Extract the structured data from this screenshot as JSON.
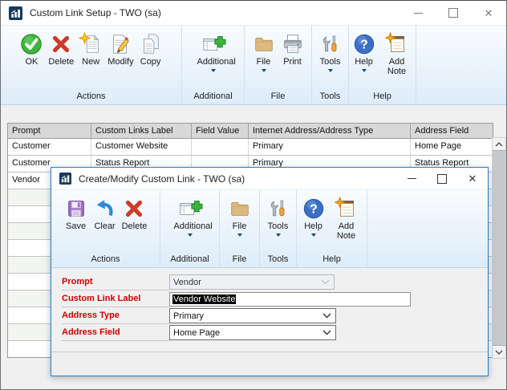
{
  "colors": {
    "dialog_border": "#1e82d2",
    "required_label_red": "#cc0000",
    "ribbon_bg_top": "#f9fcfe",
    "ribbon_bg_bottom": "#ddecf9",
    "table_header_bg": "#d8d8d8",
    "selection_bg": "#000000",
    "selection_text": "#ffffff"
  },
  "main_window": {
    "title": "Custom Link Setup  -  TWO (sa)",
    "toolbar": {
      "groups": [
        {
          "label": "Actions",
          "buttons": [
            {
              "label": "OK"
            },
            {
              "label": "Delete"
            },
            {
              "label": "New"
            },
            {
              "label": "Modify"
            },
            {
              "label": "Copy"
            }
          ]
        },
        {
          "label": "Additional",
          "buttons": [
            {
              "label": "Additional",
              "dropdown": true
            }
          ]
        },
        {
          "label": "File",
          "buttons": [
            {
              "label": "File",
              "dropdown": true
            },
            {
              "label": "Print"
            }
          ]
        },
        {
          "label": "Tools",
          "buttons": [
            {
              "label": "Tools",
              "dropdown": true
            }
          ]
        },
        {
          "label": "Help",
          "buttons": [
            {
              "label": "Help",
              "dropdown": true
            },
            {
              "label": "Add Note"
            }
          ]
        }
      ]
    },
    "table": {
      "columns": [
        "Prompt",
        "Custom Links Label",
        "Field Value",
        "Internet Address/Address Type",
        "Address Field"
      ],
      "rows": [
        [
          "Customer",
          "Customer Website",
          "",
          "Primary",
          "Home Page"
        ],
        [
          "Customer",
          "Status Report",
          "",
          "Primary",
          "Status Report"
        ],
        [
          "Vendor",
          "",
          "",
          "",
          ""
        ]
      ]
    }
  },
  "dialog": {
    "title": "Create/Modify Custom Link  -  TWO (sa)",
    "toolbar": {
      "groups": [
        {
          "label": "Actions",
          "buttons": [
            {
              "label": "Save"
            },
            {
              "label": "Clear"
            },
            {
              "label": "Delete"
            }
          ]
        },
        {
          "label": "Additional",
          "buttons": [
            {
              "label": "Additional",
              "dropdown": true
            }
          ]
        },
        {
          "label": "File",
          "buttons": [
            {
              "label": "File",
              "dropdown": true
            }
          ]
        },
        {
          "label": "Tools",
          "buttons": [
            {
              "label": "Tools",
              "dropdown": true
            }
          ]
        },
        {
          "label": "Help",
          "buttons": [
            {
              "label": "Help",
              "dropdown": true
            },
            {
              "label": "Add Note"
            }
          ]
        }
      ]
    },
    "form": {
      "fields": [
        {
          "label": "Prompt",
          "value": "Vendor",
          "state": "disabled-combo"
        },
        {
          "label": "Custom Link Label",
          "value": "Vendor Website",
          "state": "text-selected"
        },
        {
          "label": "Address Type",
          "value": "Primary",
          "state": "combo"
        },
        {
          "label": "Address Field",
          "value": "Home Page",
          "state": "combo"
        }
      ]
    }
  }
}
